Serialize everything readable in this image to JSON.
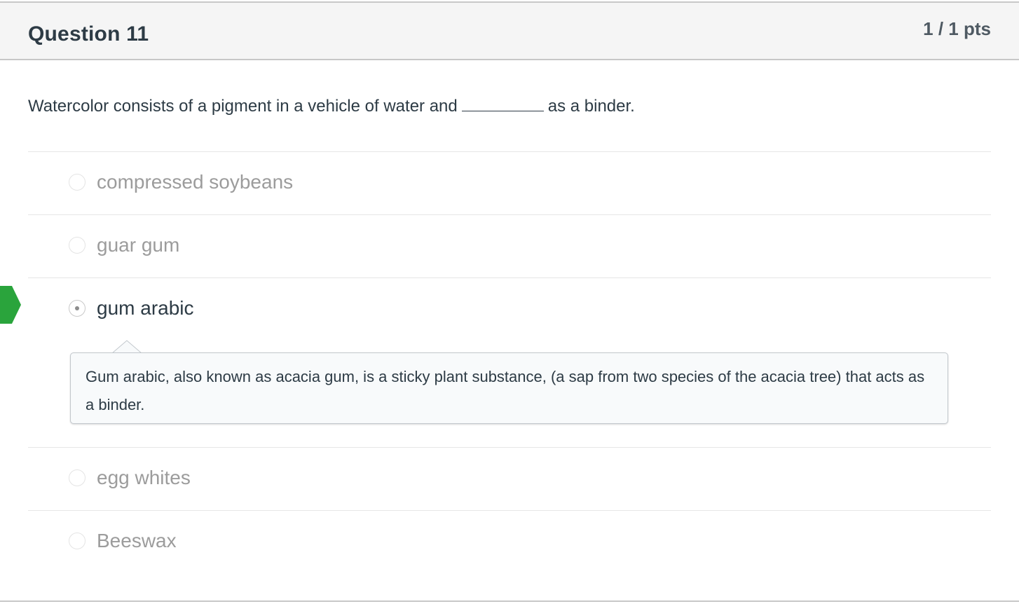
{
  "question": {
    "title": "Question 11",
    "points": "1 / 1 pts",
    "text_before": "Watercolor consists of a pigment in a vehicle of water and",
    "text_after": "as a binder."
  },
  "answers": [
    {
      "label": "compressed soybeans",
      "selected": false
    },
    {
      "label": "guar gum",
      "selected": false
    },
    {
      "label": "gum arabic",
      "selected": true,
      "correct": true
    },
    {
      "label": "egg whites",
      "selected": false
    },
    {
      "label": "Beeswax",
      "selected": false
    }
  ],
  "comment": {
    "text": "Gum arabic, also known as acacia gum, is a sticky plant substance, (a sap from two species of the acacia tree) that acts as a binder."
  },
  "colors": {
    "correct_marker": "#2aa43c",
    "text_dark": "#2d3b45",
    "text_muted": "#9c9c9c",
    "header_bg": "#f5f5f5"
  }
}
